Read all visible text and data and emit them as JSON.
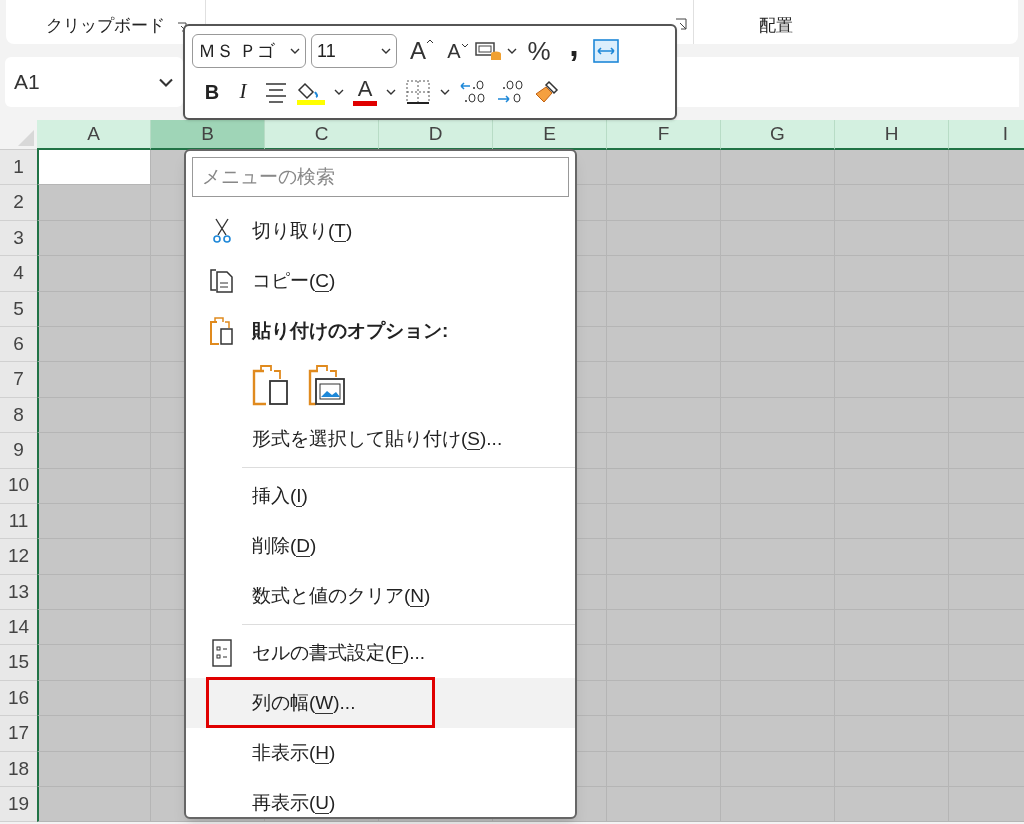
{
  "ribbon": {
    "groups": [
      {
        "label": "クリップボード"
      },
      {
        "label": "配置"
      }
    ]
  },
  "name_box": {
    "value": "A1"
  },
  "mini_toolbar": {
    "font_name": "ＭＳ Ｐゴ",
    "font_size": "11",
    "grow": "A",
    "shrink": "A",
    "percent": "%",
    "comma": ",",
    "bold": "B",
    "italic": "I",
    "font_color": "A"
  },
  "sheet": {
    "columns": [
      {
        "label": "A",
        "selected": false
      },
      {
        "label": "B",
        "selected": true
      },
      {
        "label": "C",
        "selected": false
      },
      {
        "label": "D",
        "selected": false
      },
      {
        "label": "E",
        "selected": false
      },
      {
        "label": "F",
        "selected": false
      },
      {
        "label": "G",
        "selected": false
      },
      {
        "label": "H",
        "selected": false
      },
      {
        "label": "I",
        "selected": false
      }
    ],
    "rows": [
      "1",
      "2",
      "3",
      "4",
      "5",
      "6",
      "7",
      "8",
      "9",
      "10",
      "11",
      "12",
      "13",
      "14",
      "15",
      "16",
      "17",
      "18",
      "19"
    ]
  },
  "context_menu": {
    "search": {
      "placeholder": "メニューの検索"
    },
    "items": [
      {
        "kind": "cut",
        "before": "切り取り(",
        "key": "T",
        "after": ")",
        "selected": false
      },
      {
        "kind": "copy",
        "before": "コピー(",
        "key": "C",
        "after": ")",
        "selected": false
      },
      {
        "kind": "paste_header",
        "before": "貼り付けのオプション:"
      },
      {
        "kind": "paste_options"
      },
      {
        "kind": "plain",
        "before": "形式を選択して貼り付け(",
        "key": "S",
        "after": ")...",
        "selected": false
      },
      {
        "kind": "divider"
      },
      {
        "kind": "plain",
        "before": "挿入(",
        "key": "I",
        "after": ")",
        "selected": false
      },
      {
        "kind": "plain",
        "before": "削除(",
        "key": "D",
        "after": ")",
        "selected": false
      },
      {
        "kind": "plain",
        "before": "数式と値のクリア(",
        "key": "N",
        "after": ")",
        "selected": false
      },
      {
        "kind": "divider"
      },
      {
        "kind": "format",
        "before": "セルの書式設定(",
        "key": "F",
        "after": ")...",
        "selected": false
      },
      {
        "kind": "plain",
        "before": "列の幅(",
        "key": "W",
        "after": ")...",
        "selected": true
      },
      {
        "kind": "plain",
        "before": "非表示(",
        "key": "H",
        "after": ")",
        "selected": false
      },
      {
        "kind": "plain",
        "before": "再表示(",
        "key": "U",
        "after": ")",
        "selected": false
      }
    ]
  }
}
